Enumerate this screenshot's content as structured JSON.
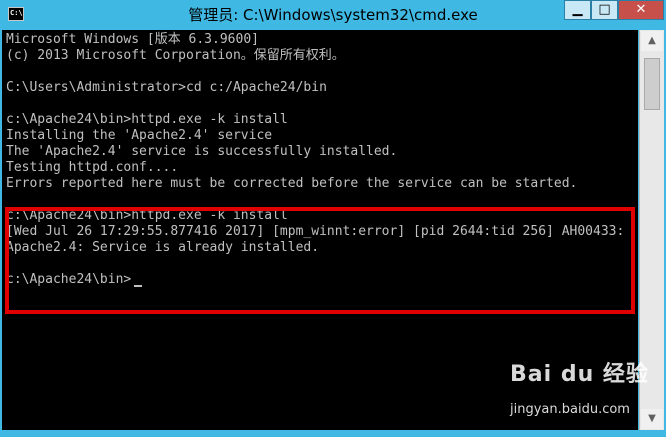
{
  "window": {
    "title": "管理员: C:\\Windows\\system32\\cmd.exe",
    "icon_label": "C:\\",
    "minimize_icon": "▁",
    "maximize_icon": "□",
    "close_icon": "✕"
  },
  "console": {
    "lines": [
      "Microsoft Windows [版本 6.3.9600]",
      "(c) 2013 Microsoft Corporation。保留所有权利。",
      "",
      "C:\\Users\\Administrator>cd c:/Apache24/bin",
      "",
      "c:\\Apache24\\bin>httpd.exe -k install",
      "Installing the 'Apache2.4' service",
      "The 'Apache2.4' service is successfully installed.",
      "Testing httpd.conf....",
      "Errors reported here must be corrected before the service can be started.",
      "",
      "c:\\Apache24\\bin>httpd.exe -k install",
      "[Wed Jul 26 17:29:55.877416 2017] [mpm_winnt:error] [pid 2644:tid 256] AH00433:",
      "Apache2.4: Service is already installed.",
      "",
      "c:\\Apache24\\bin>"
    ]
  },
  "scrollbar": {
    "up_icon": "▲",
    "down_icon": "▼"
  },
  "watermark": {
    "logo": "Bai du 经验",
    "url": "jingyan.baidu.com"
  },
  "colors": {
    "titlebar": "#3fb9e4",
    "console_bg": "#000000",
    "console_text": "#c0c0c0",
    "highlight": "#e00000",
    "close_button": "#c7504b"
  }
}
